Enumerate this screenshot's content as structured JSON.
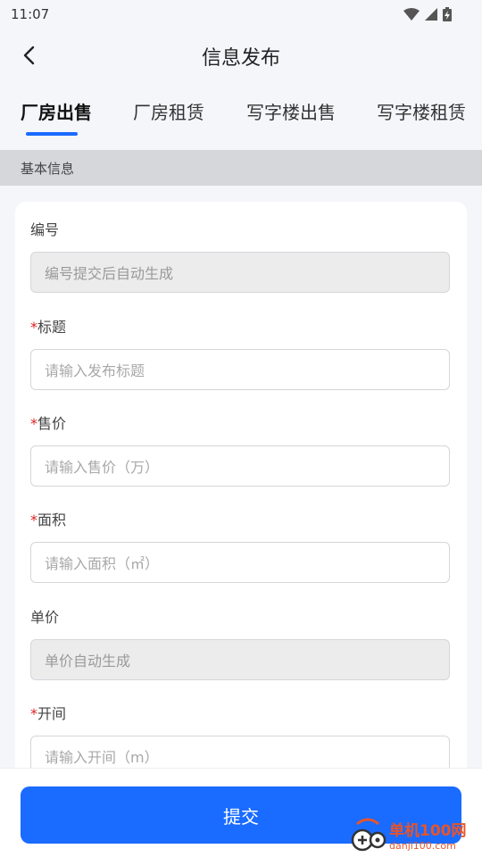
{
  "status_bar": {
    "time": "11:07"
  },
  "nav": {
    "title": "信息发布"
  },
  "tabs": [
    {
      "label": "厂房出售",
      "active": true
    },
    {
      "label": "厂房租赁",
      "active": false
    },
    {
      "label": "写字楼出售",
      "active": false
    },
    {
      "label": "写字楼租赁",
      "active": false
    }
  ],
  "section": {
    "title": "基本信息"
  },
  "form": {
    "required_mark": "*",
    "fields": [
      {
        "label": "编号",
        "required": false,
        "placeholder": "编号提交后自动生成",
        "disabled": true
      },
      {
        "label": "标题",
        "required": true,
        "placeholder": "请输入发布标题",
        "disabled": false
      },
      {
        "label": "售价",
        "required": true,
        "placeholder": "请输入售价（万）",
        "disabled": false
      },
      {
        "label": "面积",
        "required": true,
        "placeholder": "请输入面积（㎡）",
        "disabled": false
      },
      {
        "label": "单价",
        "required": false,
        "placeholder": "单价自动生成",
        "disabled": true
      },
      {
        "label": "开间",
        "required": true,
        "placeholder": "请输入开间（m）",
        "disabled": false
      }
    ]
  },
  "bottom": {
    "submit_label": "提交"
  },
  "watermark": {
    "cn": "单机100网",
    "en": "danji100.com"
  },
  "colors": {
    "accent": "#1a6bff",
    "required": "#e02020"
  }
}
